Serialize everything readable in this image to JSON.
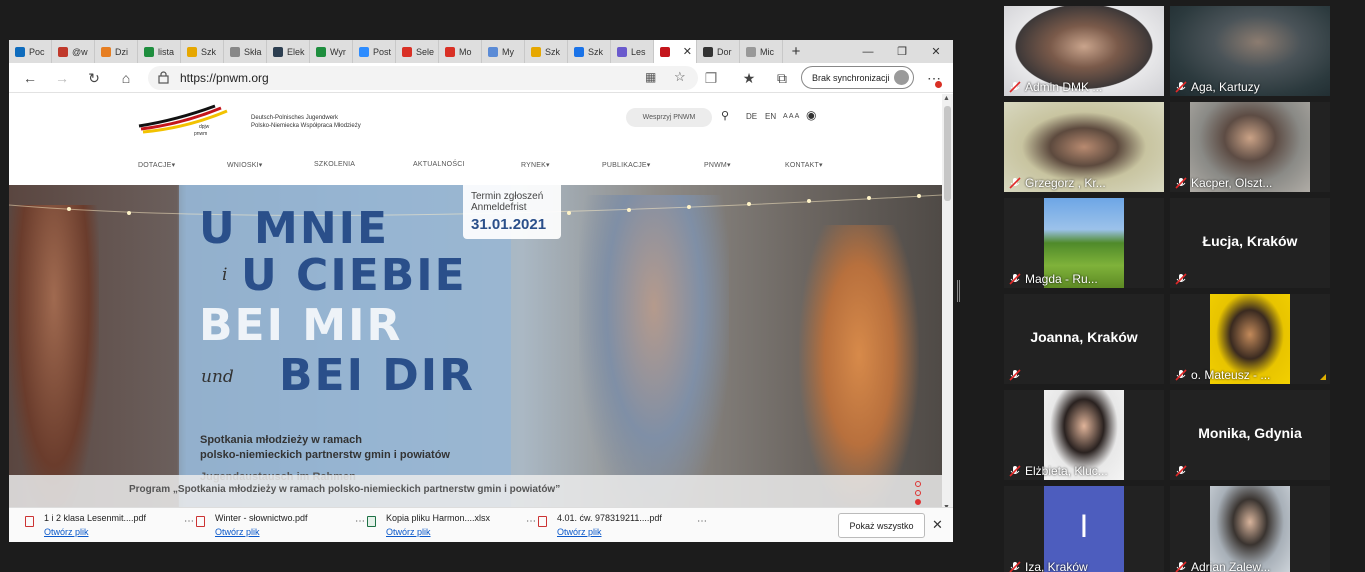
{
  "browser": {
    "tabs": [
      {
        "label": "Poc",
        "color": "#0f6cbd"
      },
      {
        "label": "@w",
        "color": "#c0392b"
      },
      {
        "label": "Dzi",
        "color": "#e67e22"
      },
      {
        "label": "lista",
        "color": "#1e8e3e"
      },
      {
        "label": "Szk",
        "color": "#e6a700"
      },
      {
        "label": "Skła",
        "color": "#888888"
      },
      {
        "label": "Elek",
        "color": "#2c3e50"
      },
      {
        "label": "Wyr",
        "color": "#1e8e3e"
      },
      {
        "label": "Post",
        "color": "#2d8cff"
      },
      {
        "label": "Sele",
        "color": "#d93025"
      },
      {
        "label": "Mo",
        "color": "#d93025"
      },
      {
        "label": "My",
        "color": "#5b8bd6"
      },
      {
        "label": "Szk",
        "color": "#e6a700"
      },
      {
        "label": "Szk",
        "color": "#1a73e8"
      },
      {
        "label": "Les",
        "color": "#6a5acd"
      },
      {
        "label": "",
        "color": "#c4161c",
        "active": true
      },
      {
        "label": "Dor",
        "color": "#333333"
      },
      {
        "label": "Mic",
        "color": "#999999"
      }
    ],
    "url": "https://pnwm.org",
    "sync_label": "Brak synchronizacji"
  },
  "site": {
    "logo_small": "dpjw\npnwm",
    "logo_line1": "Deutsch-Polnisches Jugendwerk",
    "logo_line2": "Polsko-Niemiecka Współpraca Młodzieży",
    "donate_label": "Wesprzyj PNWM",
    "lang_de": "DE",
    "lang_en": "EN",
    "font_size_label": "A A A",
    "nav": [
      "DOTACJE",
      "WNIOSKI",
      "SZKOLENIA",
      "AKTUALNOŚCI",
      "RYNEK",
      "PUBLIKACJE",
      "PNWM",
      "KONTAKT"
    ],
    "deadline_line1": "Termin zgłoszeń",
    "deadline_line2": "Anmeldefrist",
    "deadline_date": "31.01.2021",
    "headline1": "U MNIE",
    "headline_i": "i",
    "headline2": "U CIEBIE",
    "headline3": "BEI MIR",
    "headline_und": "und",
    "headline4": "BEI DIR",
    "subtitle_pl_1": "Spotkania młodzieży w ramach",
    "subtitle_pl_2": "polsko-niemieckich partnerstw gmin i powiatów",
    "subtitle_de": "Jugendaustausch im Rahmen",
    "caption": "Program „Spotkania młodzieży w ramach polsko-niemieckich partnerstw gmin i powiatów”"
  },
  "downloads": {
    "items": [
      {
        "name": "1 i 2 klasa Lesenmit....pdf",
        "open": "Otwórz plik",
        "type": "pdf"
      },
      {
        "name": "Winter - słownictwo.pdf",
        "open": "Otwórz plik",
        "type": "pdf"
      },
      {
        "name": "Kopia pliku Harmon....xlsx",
        "open": "Otwórz plik",
        "type": "xlsx"
      },
      {
        "name": "4.01. ćw. 978319211....pdf",
        "open": "Otwórz plik",
        "type": "pdf"
      }
    ],
    "show_all": "Pokaż wszystko"
  },
  "participants": [
    {
      "name": "Admin DMK ...",
      "video": true
    },
    {
      "name": "Aga, Kartuzy",
      "video": true
    },
    {
      "name": "Grzegorz , Kr...",
      "video": true
    },
    {
      "name": "Kacper, Olszt...",
      "video": true
    },
    {
      "name": "Magda - Ru...",
      "video": true
    },
    {
      "name": "Łucja, Kraków",
      "video": false
    },
    {
      "name": "Joanna, Kraków",
      "video": false
    },
    {
      "name": "o. Mateusz - ...",
      "video": true
    },
    {
      "name": "Elżbieta, Kluc...",
      "video": true
    },
    {
      "name": "Monika, Gdynia",
      "video": false
    },
    {
      "name": "Iza, Kraków",
      "video": true,
      "initial": "I"
    },
    {
      "name": "Adrian Zalew...",
      "video": true
    }
  ]
}
